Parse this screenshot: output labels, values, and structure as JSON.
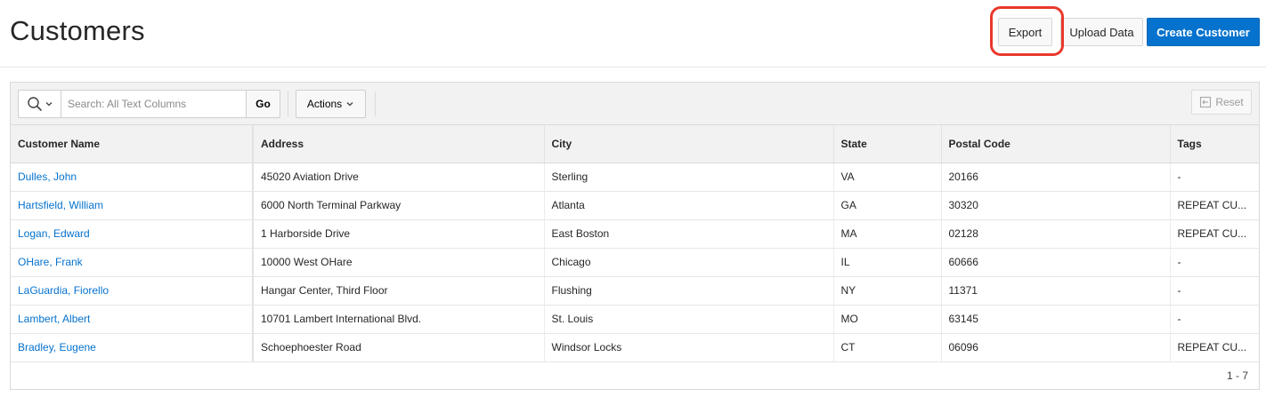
{
  "header": {
    "title": "Customers",
    "export_label": "Export",
    "upload_label": "Upload Data",
    "create_label": "Create Customer"
  },
  "colors": {
    "primary_button": "#0572ce",
    "link": "#0572ce",
    "highlight_ring": "#e9382b"
  },
  "toolbar": {
    "search_icon": "search-icon",
    "search_placeholder": "Search: All Text Columns",
    "go_label": "Go",
    "actions_label": "Actions",
    "reset_label": "Reset"
  },
  "table": {
    "columns": [
      "Customer Name",
      "Address",
      "City",
      "State",
      "Postal Code",
      "Tags"
    ],
    "rows": [
      [
        "Dulles, John",
        "45020 Aviation Drive",
        "Sterling",
        "VA",
        "20166",
        "-"
      ],
      [
        "Hartsfield, William",
        "6000 North Terminal Parkway",
        "Atlanta",
        "GA",
        "30320",
        "REPEAT CU..."
      ],
      [
        "Logan, Edward",
        "1 Harborside Drive",
        "East Boston",
        "MA",
        "02128",
        "REPEAT CU..."
      ],
      [
        "OHare, Frank",
        "10000 West OHare",
        "Chicago",
        "IL",
        "60666",
        "-"
      ],
      [
        "LaGuardia, Fiorello",
        "Hangar Center, Third Floor",
        "Flushing",
        "NY",
        "11371",
        "-"
      ],
      [
        "Lambert, Albert",
        "10701 Lambert International Blvd.",
        "St. Louis",
        "MO",
        "63145",
        "-"
      ],
      [
        "Bradley, Eugene",
        "Schoephoester Road",
        "Windsor Locks",
        "CT",
        "06096",
        "REPEAT CU..."
      ]
    ],
    "pagination": "1 - 7"
  }
}
